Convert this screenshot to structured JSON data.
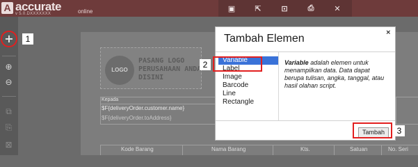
{
  "brand": {
    "name": "accurate",
    "sub": "online",
    "version": "v 5.0.DXXXXXXX"
  },
  "toolbar": {
    "icons": [
      "save-icon",
      "export-icon",
      "preview-icon",
      "print-settings-icon",
      "close-icon"
    ],
    "glyphs": [
      "▣",
      "⇱",
      "⊡",
      "⎙",
      "✕"
    ]
  },
  "sidebar": {
    "add": "+",
    "zoom_in": "⊕",
    "zoom_out": "⊖",
    "copy": "⧉",
    "paste": "⎘",
    "delete": "⊠"
  },
  "callouts": {
    "c1": "1",
    "c2": "2",
    "c3": "3"
  },
  "canvas": {
    "logo_circle": "LOGO",
    "logo_text": "PASANG LOGO PERUSAHAAN ANDA DISINI",
    "kepada": "Kepada",
    "field_customer": "$F{deliveryOrder.customer.name}",
    "field_address": "$F{deliveryOrder.toAddress}",
    "columns": [
      "Kode Barang",
      "Nama Barang",
      "Kts.",
      "Satuan",
      "No. Seri"
    ]
  },
  "dialog": {
    "title": "Tambah Elemen",
    "close": "×",
    "items": [
      "Variable",
      "Label",
      "Image",
      "Barcode",
      "Line",
      "Rectangle"
    ],
    "selected_index": 0,
    "desc_bold": "Variable",
    "desc_rest": " adalah elemen untuk menampilkan data. Data dapat berupa tulisan, angka, tanggal, atau hasil olahan script.",
    "button": "Tambah"
  },
  "colors": {
    "topbar": "#6e3b3b",
    "highlight": "#e21f1f",
    "selection": "#3a72d8"
  }
}
